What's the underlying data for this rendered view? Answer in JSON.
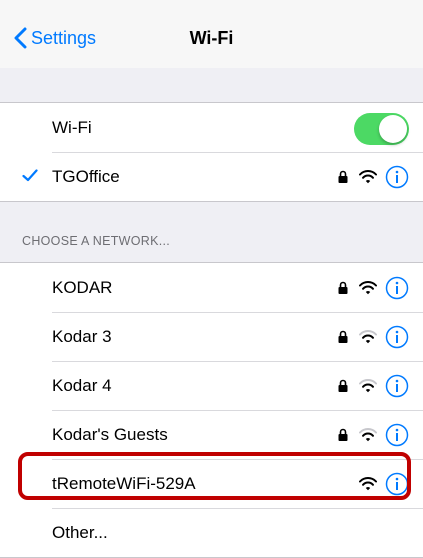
{
  "navbar": {
    "back_label": "Settings",
    "title": "Wi-Fi"
  },
  "wifi_toggle": {
    "label": "Wi-Fi",
    "on": true,
    "on_color": "#4cd964"
  },
  "connected": {
    "name": "TGOffice",
    "secured": true,
    "icons": [
      "checkmark-icon",
      "lock-icon",
      "wifi-icon",
      "info-icon"
    ]
  },
  "section_header": "CHOOSE A NETWORK...",
  "networks": [
    {
      "name": "KODAR",
      "secured": true
    },
    {
      "name": "Kodar 3",
      "secured": true
    },
    {
      "name": "Kodar 4",
      "secured": true
    },
    {
      "name": "Kodar's Guests",
      "secured": true
    },
    {
      "name": "tRemoteWiFi-529A",
      "secured": false,
      "highlighted": true
    },
    {
      "name": "Other..."
    }
  ],
  "colors": {
    "accent": "#007aff",
    "highlight_border": "#c00000",
    "background": "#efeff4"
  }
}
